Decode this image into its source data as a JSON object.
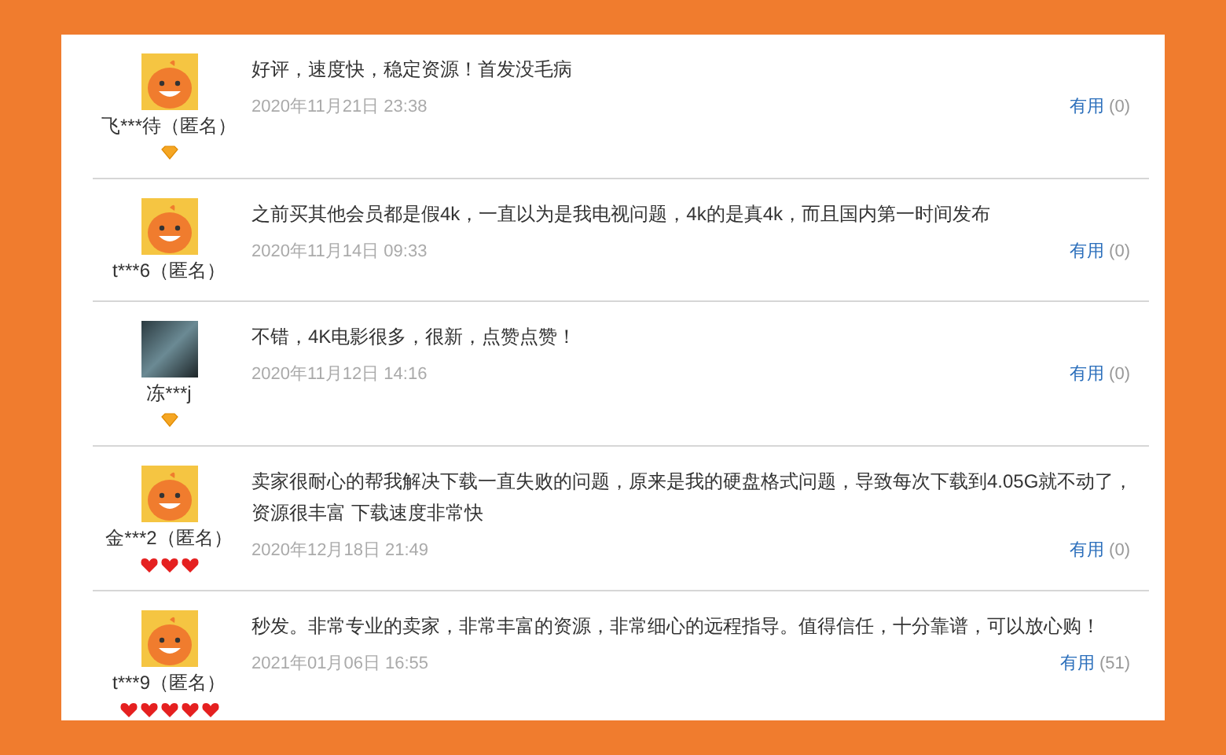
{
  "reviews": [
    {
      "user": "飞***待（匿名）",
      "avatar": {
        "kind": "mascot"
      },
      "badges": [
        {
          "kind": "diamond"
        }
      ],
      "text": "好评，速度快，稳定资源！首发没毛病",
      "date": "2020年11月21日 23:38",
      "useful_label": "有用",
      "useful_count": "(0)"
    },
    {
      "user": "t***6（匿名）",
      "avatar": {
        "kind": "mascot"
      },
      "text": "之前买其他会员都是假4k，一直以为是我电视问题，4k的是真4k，而且国内第一时间发布",
      "date": "2020年11月14日 09:33",
      "useful_label": "有用",
      "useful_count": "(0)"
    },
    {
      "user": "冻***j",
      "avatar": {
        "kind": "photo"
      },
      "badges": [
        {
          "kind": "diamond"
        }
      ],
      "text": "不错，4K电影很多，很新，点赞点赞！",
      "date": "2020年11月12日 14:16",
      "useful_label": "有用",
      "useful_count": "(0)"
    },
    {
      "user": "金***2（匿名）",
      "avatar": {
        "kind": "mascot"
      },
      "badges": [
        {
          "kind": "heart"
        },
        {
          "kind": "heart"
        },
        {
          "kind": "heart"
        }
      ],
      "text": "卖家很耐心的帮我解决下载一直失败的问题，原来是我的硬盘格式问题，导致每次下载到4.05G就不动了，资源很丰富 下载速度非常快",
      "date": "2020年12月18日 21:49",
      "useful_label": "有用",
      "useful_count": "(0)"
    },
    {
      "user": "t***9（匿名）",
      "avatar": {
        "kind": "mascot"
      },
      "badges": [
        {
          "kind": "heart"
        },
        {
          "kind": "heart"
        },
        {
          "kind": "heart"
        },
        {
          "kind": "heart"
        },
        {
          "kind": "heart"
        }
      ],
      "text": "秒发。非常专业的卖家，非常丰富的资源，非常细心的远程指导。值得信任，十分靠谱，可以放心购！",
      "date": "2021年01月06日 16:55",
      "useful_label": "有用",
      "useful_count": "(51)"
    }
  ]
}
